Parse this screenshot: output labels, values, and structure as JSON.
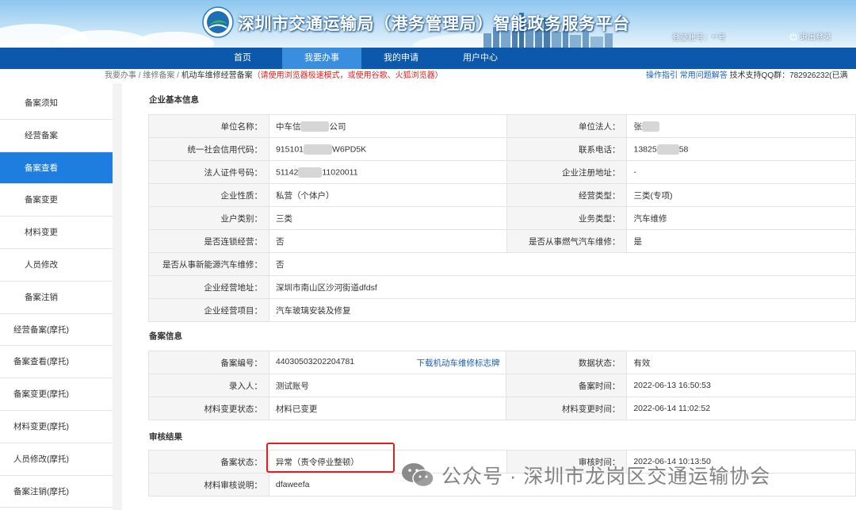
{
  "header": {
    "site_title": "深圳市交通运输局（港务管理局）智能政务服务平台",
    "login_account": "登录账号：**号",
    "logout": "退出登录"
  },
  "nav": {
    "items": [
      {
        "label": "首页"
      },
      {
        "label": "我要办事"
      },
      {
        "label": "我的申请"
      },
      {
        "label": "用户中心"
      }
    ],
    "active_index": 1
  },
  "breadcrumb": {
    "part1": "我要办事",
    "sep": " / ",
    "part2": "维修备案",
    "part3": "机动车维修经营备案",
    "warning": "（请使用浏览器极速模式，或使用谷歌、火狐浏览器）"
  },
  "help": {
    "guide": "操作指引",
    "faq": "常用问题解答",
    "support": "技术支持QQ群：782926232(已满"
  },
  "sidebar": {
    "items": [
      {
        "label": "备案须知"
      },
      {
        "label": "经营备案"
      },
      {
        "label": "备案查看"
      },
      {
        "label": "备案变更"
      },
      {
        "label": "材料变更"
      },
      {
        "label": "人员修改"
      },
      {
        "label": "备案注销"
      },
      {
        "label": "经营备案(摩托)"
      },
      {
        "label": "备案查看(摩托)"
      },
      {
        "label": "备案变更(摩托)"
      },
      {
        "label": "材料变更(摩托)"
      },
      {
        "label": "人员修改(摩托)"
      },
      {
        "label": "备案注销(摩托)"
      }
    ],
    "active_index": 2
  },
  "enterprise": {
    "title": "企业基本信息",
    "unit_name_label": "单位名称：",
    "unit_name_a": "中车信",
    "unit_name_b": "公司",
    "legal_person_label": "单位法人：",
    "legal_person_a": "张",
    "credit_code_label": "统一社会信用代码：",
    "credit_code_a": "915101",
    "credit_code_b": "W6PD5K",
    "phone_label": "联系电话：",
    "phone_a": "13825",
    "phone_b": "58",
    "id_no_label": "法人证件号码：",
    "id_no_a": "51142",
    "id_no_b": "11020011",
    "reg_addr_label": "企业注册地址：",
    "reg_addr": "-",
    "nature_label": "企业性质：",
    "nature": "私营（个体户）",
    "biz_type_label": "经营类型：",
    "biz_type": "三类(专项)",
    "household_label": "业户类别：",
    "household": "三类",
    "service_type_label": "业务类型：",
    "service_type": "汽车维修",
    "chain_label": "是否连锁经营：",
    "chain": "否",
    "gas_label": "是否从事燃气汽车维修：",
    "gas": "是",
    "nev_label": "是否从事新能源汽车维修：",
    "nev": "否",
    "address_label": "企业经营地址：",
    "address": "深圳市南山区沙河街道dfdsf",
    "items_label": "企业经营项目：",
    "items": "汽车玻璃安装及修复"
  },
  "filing": {
    "title": "备案信息",
    "no_label": "备案编号：",
    "no": "44030503202204781",
    "download": "下载机动车维修标志牌",
    "data_status_label": "数据状态：",
    "data_status": "有效",
    "entrant_label": "录入人：",
    "entrant": "测试账号",
    "filing_time_label": "备案时间：",
    "filing_time": "2022-06-13 16:50:53",
    "mat_status_label": "材料变更状态：",
    "mat_status": "材料已变更",
    "mat_time_label": "材料变更时间：",
    "mat_time": "2022-06-14 11:02:52"
  },
  "review": {
    "title": "审核结果",
    "status_label": "备案状态：",
    "status": "异常（责令停业整顿）",
    "time_label": "审核时间：",
    "time": "2022-06-14 10:13:50",
    "note_label": "材料审核说明：",
    "note": "dfaweefa"
  },
  "watermark": {
    "text": "公众号 · 深圳市龙岗区交通运输协会"
  },
  "colors": {
    "nav_bg": "#0b58ac",
    "nav_active": "#3a8ee0",
    "sidebar_active": "#1e7ee0",
    "warning_red": "#e02020",
    "valid_green": "#19a319",
    "link_blue": "#1a5fb4"
  }
}
